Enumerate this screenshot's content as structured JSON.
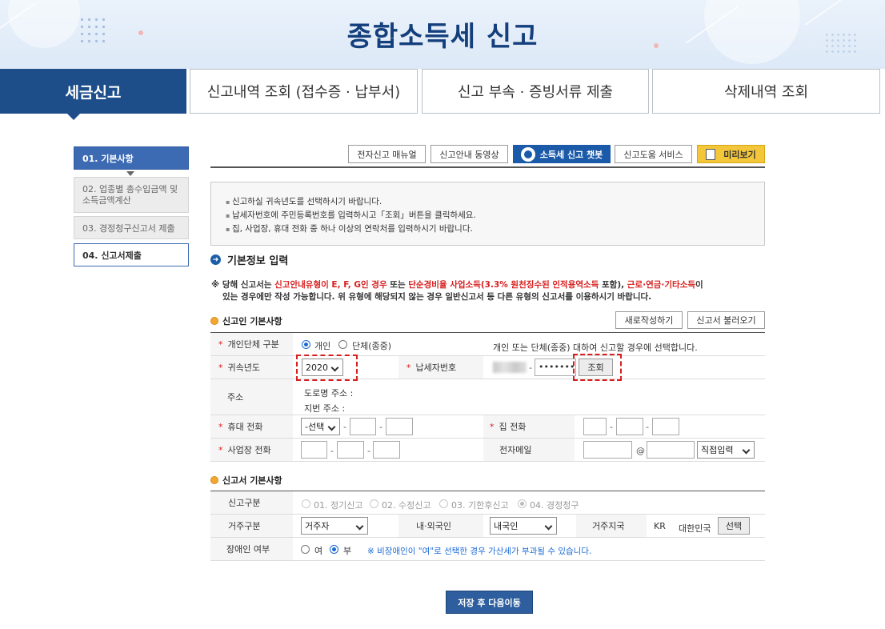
{
  "header": {
    "title": "종합소득세 신고"
  },
  "tabs": [
    {
      "label": "세금신고"
    },
    {
      "label": "신고내역 조회 (접수증 · 납부서)"
    },
    {
      "label": "신고 부속 · 증빙서류 제출"
    },
    {
      "label": "삭제내역 조회"
    }
  ],
  "steps": [
    {
      "label": "01. 기본사항"
    },
    {
      "label": "02. 업종별 총수입금액 및 소득금액계산"
    },
    {
      "label": "03. 경정청구신고서 제출"
    },
    {
      "label": "04. 신고서제출"
    }
  ],
  "toolbar": {
    "manual": "전자신고 매뉴얼",
    "video": "신고안내 동영상",
    "chatbot": "소득세 신고 챗봇",
    "help": "신고도움 서비스",
    "preview": "미리보기"
  },
  "notice": [
    "신고하실 귀속년도를 선택하시기 바랍니다.",
    "납세자번호에 주민등록번호를 입력하시고「조회」버튼을 클릭하세요.",
    "집, 사업장, 휴대 전화 중 하나 이상의 연락처를 입력하시기 바랍니다."
  ],
  "section_title": "기본정보 입력",
  "warning": {
    "p1": "※ 당해 신고서는 ",
    "r1": "신고안내유형이 E, F, G인 경우",
    "p2": " 또는 ",
    "r2": "단순경비율 사업소득(3.3% 원천징수된 인적용역소득",
    "p3": " 포함), ",
    "r3": "근로·연금·기타소득",
    "p4": "이",
    "line2": "있는 경우에만 작성 가능합니다. 위 유형에 해당되지 않는 경우 일반신고서 등 다른 유형의 신고서를 이용하시기 바랍니다."
  },
  "filer_section": {
    "title": "신고인 기본사항",
    "new_button": "새로작성하기",
    "load_button": "신고서 불러오기",
    "type_label": "개인단체 구분",
    "type_personal": "개인",
    "type_group": "단체(종중)",
    "type_note": "개인 또는 단체(종중) 대하여 신고할 경우에 선택합니다.",
    "year_label": "귀속년도",
    "year_value": "2020",
    "taxpayer_label": "납세자번호",
    "taxpayer_mask": "•••••••",
    "lookup_button": "조회",
    "address_label": "주소",
    "road_address": "도로명 주소 :",
    "lot_address": "지번 주소 :",
    "mobile_label": "휴대 전화",
    "mobile_select": "-선택",
    "home_label": "집 전화",
    "office_label": "사업장 전화",
    "email_label": "전자메일",
    "email_at": "@",
    "email_domain": "직접입력"
  },
  "report_section": {
    "title": "신고서 기본사항",
    "kind_label": "신고구분",
    "kinds": [
      "01. 정기신고",
      "02. 수정신고",
      "03. 기한후신고",
      "04. 경정청구"
    ],
    "residence_label": "거주구분",
    "residence_value": "거주자",
    "nationality_label": "내·외국인",
    "nationality_value": "내국인",
    "country_label": "거주지국",
    "country_code": "KR",
    "country_name": "대한민국",
    "country_button": "선택",
    "disabled_label": "장애인 여부",
    "yes": "여",
    "no": "부",
    "disabled_note": "※ 비장애인이 \"여\"로 선택한 경우 가산세가 부과될 수 있습니다."
  },
  "save_button": "저장 후 다음이동",
  "colors": {
    "primary": "#1d4e8a",
    "accent_red": "#d81e1e",
    "chatbot": "#1a5aa8",
    "preview": "#f4c63a"
  }
}
